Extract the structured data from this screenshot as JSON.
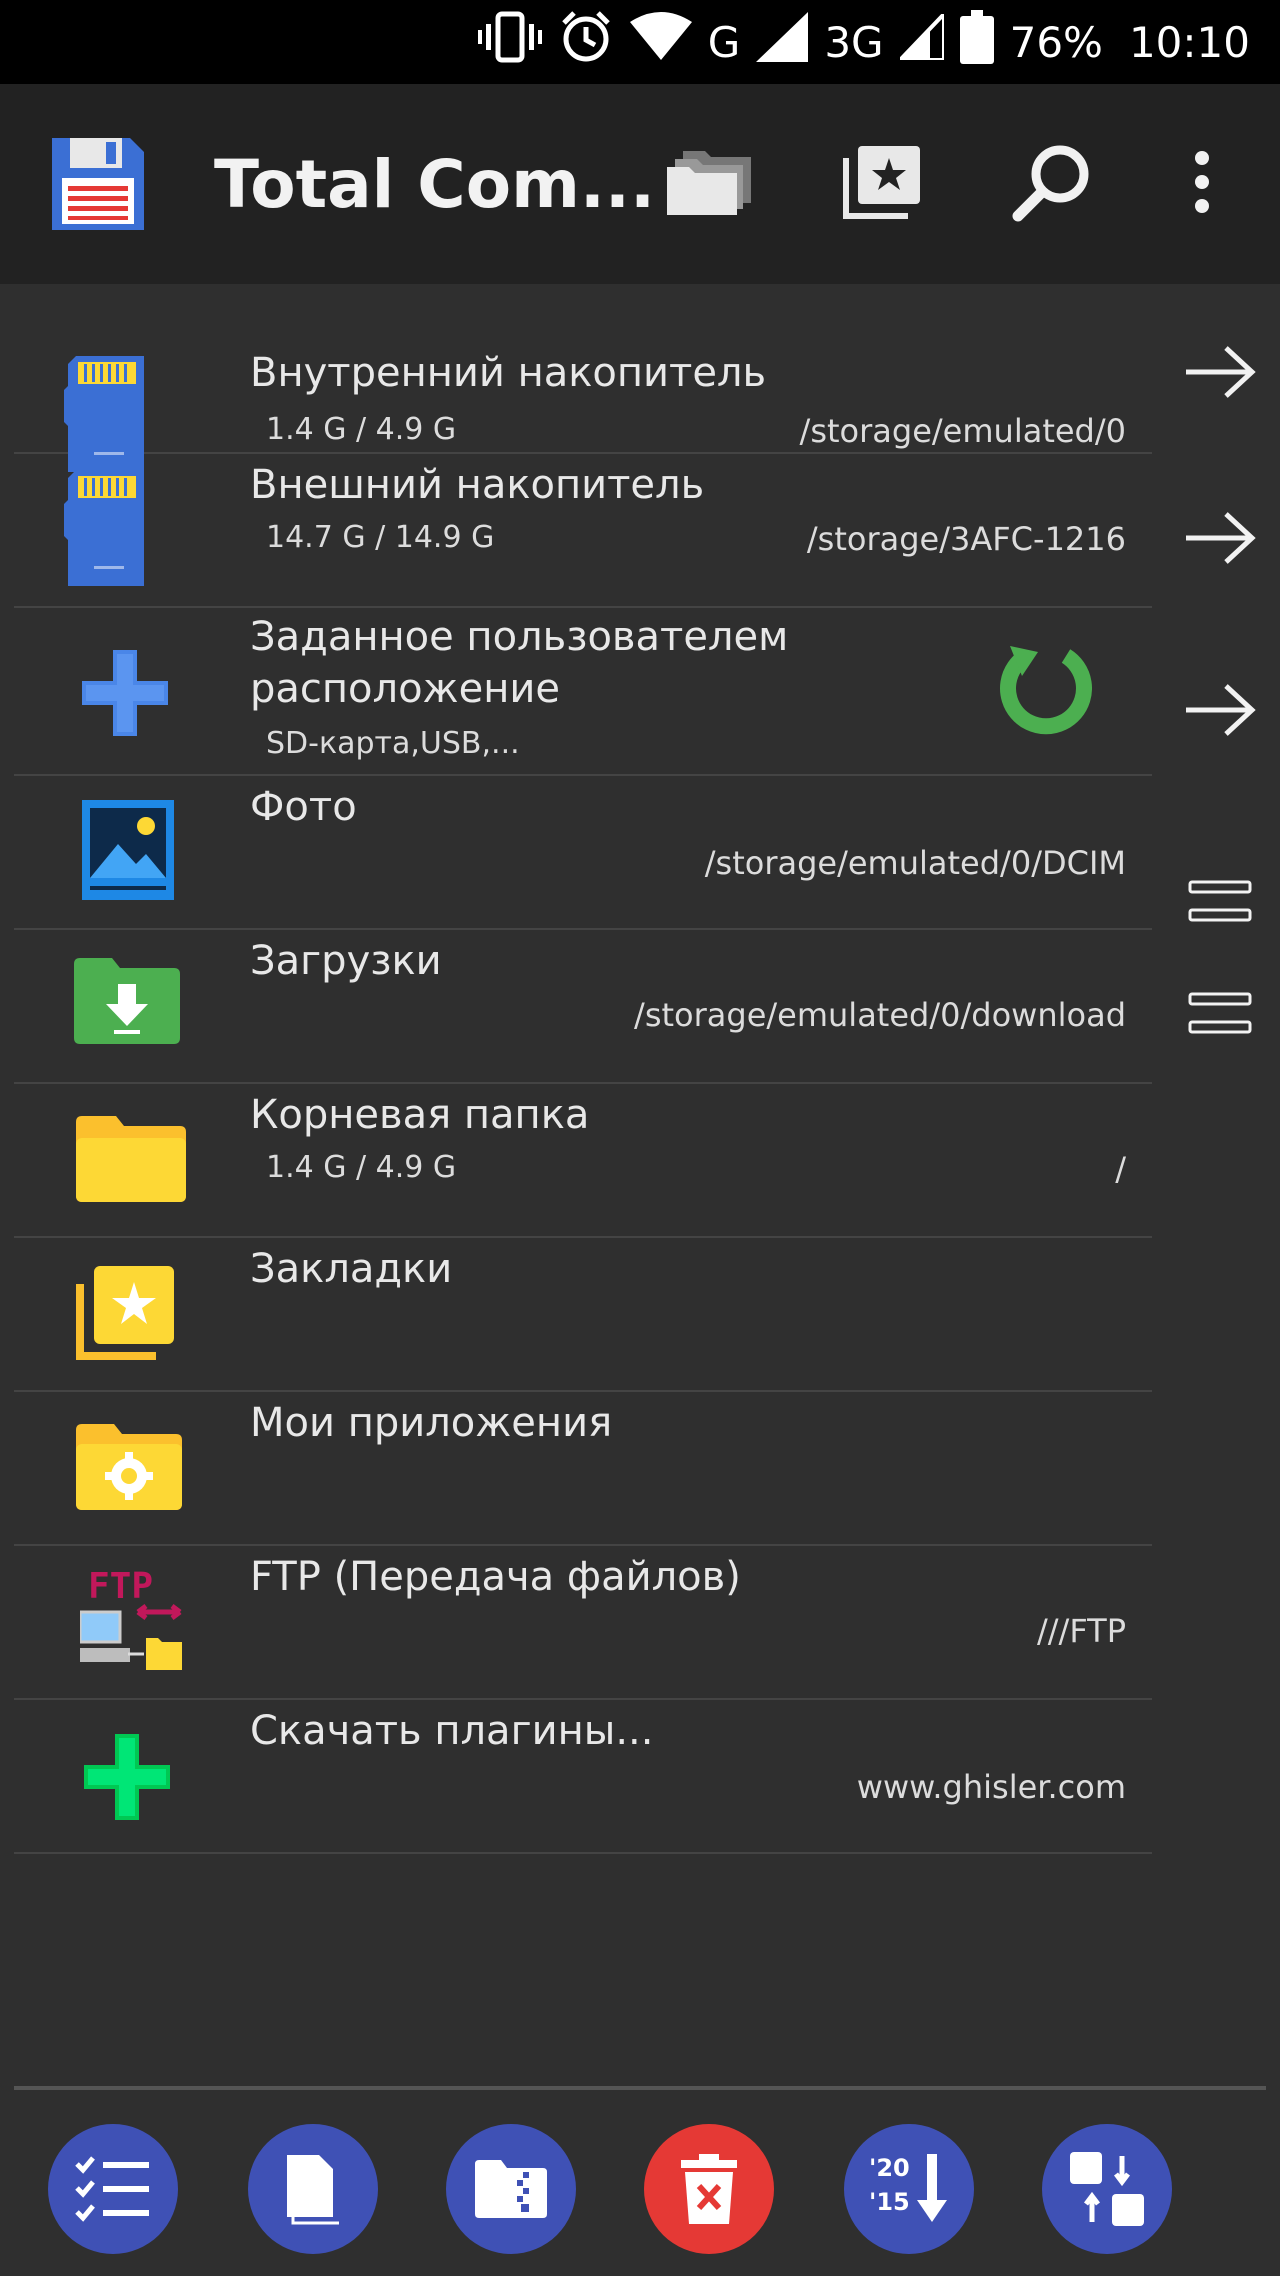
{
  "status_bar": {
    "network_g": "G",
    "network_3g": "3G",
    "battery": "76%",
    "time": "10:10"
  },
  "app_bar": {
    "title": "Total Com..."
  },
  "items": [
    {
      "title": "Внутренний накопитель",
      "sub_left": "1.4 G / 4.9 G",
      "sub_right": "/storage/emulated/0"
    },
    {
      "title": "Внешний накопитель",
      "sub_left": "14.7 G / 14.9 G",
      "sub_right": "/storage/3AFC-1216"
    },
    {
      "title_line1": "Заданное пользователем",
      "title_line2": "расположение",
      "sub_left": "SD-карта,USB,..."
    },
    {
      "title": "Фото",
      "sub_right": "/storage/emulated/0/DCIM"
    },
    {
      "title": "Загрузки",
      "sub_right": "/storage/emulated/0/download"
    },
    {
      "title": "Корневая папка",
      "sub_left": "1.4 G / 4.9 G",
      "sub_right": "/"
    },
    {
      "title": "Закладки"
    },
    {
      "title": "Мои приложения"
    },
    {
      "title": "FTP (Передача файлов)",
      "sub_right": "///FTP",
      "icon_text": "FTP"
    },
    {
      "title": "Скачать плагины...",
      "sub_right": "www.ghisler.com"
    }
  ],
  "toolbar": {
    "sort_icon_top": "'20",
    "sort_icon_bottom": "'15"
  },
  "colors": {
    "background": "#2f2f2f",
    "appbar": "#222222",
    "accent_blue": "#3f51b5",
    "delete_red": "#e53935",
    "folder_yellow": "#fbc02d",
    "green": "#4caf50"
  }
}
